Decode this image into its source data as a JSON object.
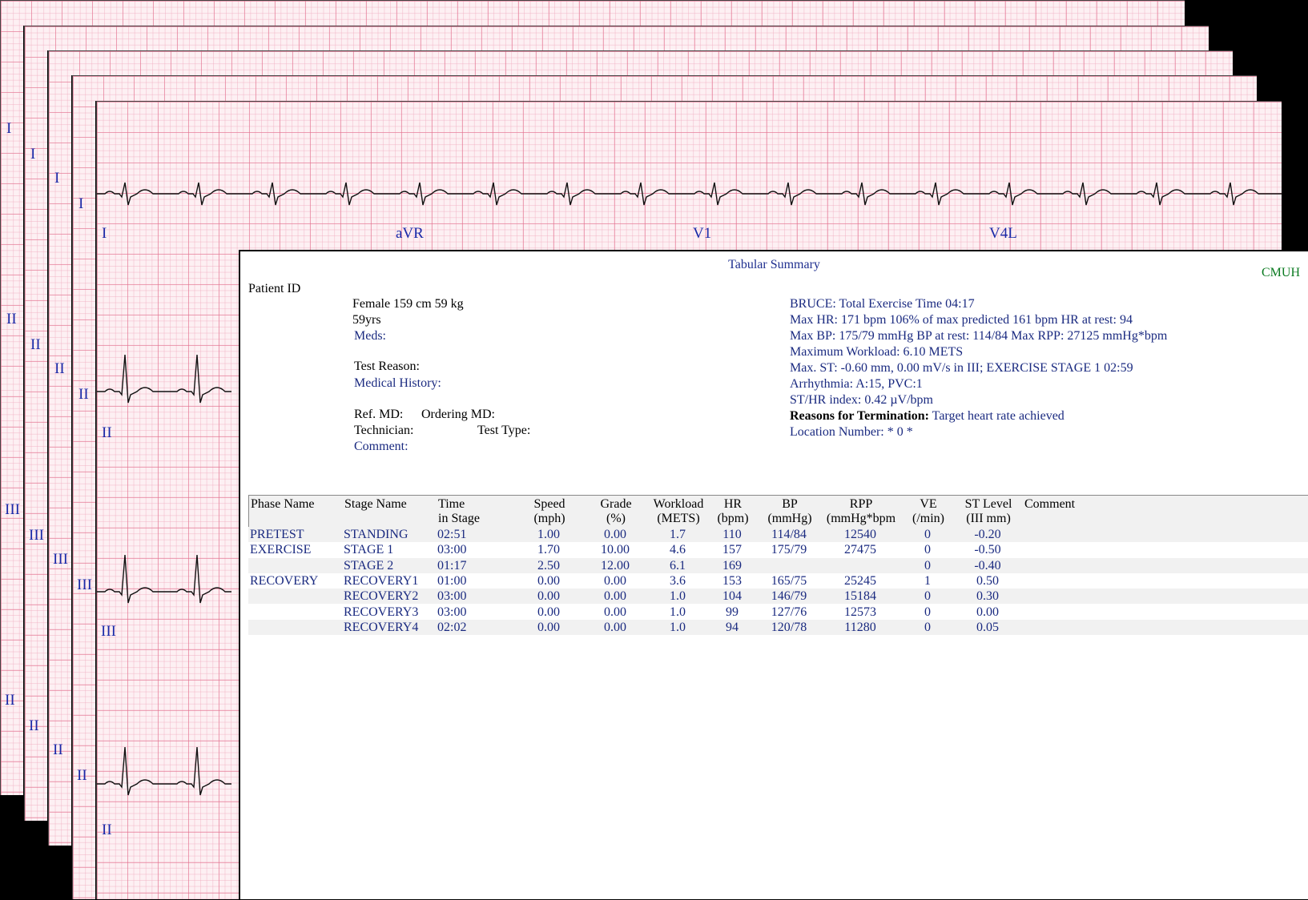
{
  "sheets": [
    {
      "labels": [
        "I",
        "II",
        "III",
        "II"
      ]
    },
    {
      "labels": [
        "I",
        "II",
        "III",
        "II"
      ]
    },
    {
      "labels": [
        "I",
        "II",
        "III",
        "II"
      ]
    },
    {
      "labels": [
        "I",
        "II",
        "III",
        "II"
      ]
    },
    {
      "labels": [
        "I",
        "aVR",
        "V1",
        "V4L",
        "II",
        "III",
        "II"
      ]
    }
  ],
  "summary": {
    "title": "Tabular Summary",
    "brand": "CMUH",
    "patient_id_label": "Patient ID",
    "patient": {
      "line1": "Female   159 cm   59 kg",
      "age": "59yrs",
      "meds": "Meds:",
      "test_reason": "Test Reason:",
      "medical_history": "Medical History:",
      "ref_md": "Ref. MD:",
      "ordering_md": "Ordering MD:",
      "technician": "Technician:",
      "test_type": "Test Type:",
      "comment": "Comment:"
    },
    "results": {
      "line1": "BRUCE: Total Exercise Time  04:17",
      "line2": "Max HR: 171 bpm   106% of max predicted 161 bpm    HR at rest:  94",
      "line3": "Max BP: 175/79 mmHg    BP at rest:  114/84    Max RPP:  27125 mmHg*bpm",
      "line4": "Maximum Workload: 6.10 METS",
      "line5": "Max. ST: -0.60 mm,  0.00 mV/s  in III; EXERCISE  STAGE 1   02:59",
      "line6": "Arrhythmia: A:15,   PVC:1",
      "line7": "ST/HR index: 0.42 µV/bpm",
      "termination_label": "Reasons for Termination:",
      "termination_value": "Target heart rate achieved",
      "location": "Location Number: * 0 *"
    },
    "table": {
      "headers": [
        {
          "l1": "Phase Name",
          "l2": ""
        },
        {
          "l1": "Stage Name",
          "l2": ""
        },
        {
          "l1": "Time",
          "l2": "in Stage"
        },
        {
          "l1": "Speed",
          "l2": "(mph)"
        },
        {
          "l1": "Grade",
          "l2": "(%)"
        },
        {
          "l1": "Workload",
          "l2": "(METS)"
        },
        {
          "l1": "HR",
          "l2": "(bpm)"
        },
        {
          "l1": "BP",
          "l2": "(mmHg)"
        },
        {
          "l1": "RPP",
          "l2": "(mmHg*bpm"
        },
        {
          "l1": "VE",
          "l2": "(/min)"
        },
        {
          "l1": "ST Level",
          "l2": "(III mm)"
        },
        {
          "l1": "Comment",
          "l2": ""
        }
      ],
      "rows": [
        [
          "PRETEST",
          "STANDING",
          "02:51",
          "1.00",
          "0.00",
          "1.7",
          "110",
          "114/84",
          "12540",
          "0",
          "-0.20",
          ""
        ],
        [
          "EXERCISE",
          "STAGE 1",
          "03:00",
          "1.70",
          "10.00",
          "4.6",
          "157",
          "175/79",
          "27475",
          "0",
          "-0.50",
          ""
        ],
        [
          "",
          "STAGE 2",
          "01:17",
          "2.50",
          "12.00",
          "6.1",
          "169",
          "",
          "",
          "0",
          "-0.40",
          ""
        ],
        [
          "RECOVERY",
          "RECOVERY1",
          "01:00",
          "0.00",
          "0.00",
          "3.6",
          "153",
          "165/75",
          "25245",
          "1",
          "0.50",
          ""
        ],
        [
          "",
          "RECOVERY2",
          "03:00",
          "0.00",
          "0.00",
          "1.0",
          "104",
          "146/79",
          "15184",
          "0",
          "0.30",
          ""
        ],
        [
          "",
          "RECOVERY3",
          "03:00",
          "0.00",
          "0.00",
          "1.0",
          "99",
          "127/76",
          "12573",
          "0",
          "0.00",
          ""
        ],
        [
          "",
          "RECOVERY4",
          "02:02",
          "0.00",
          "0.00",
          "1.0",
          "94",
          "120/78",
          "11280",
          "0",
          "0.05",
          ""
        ]
      ]
    }
  }
}
